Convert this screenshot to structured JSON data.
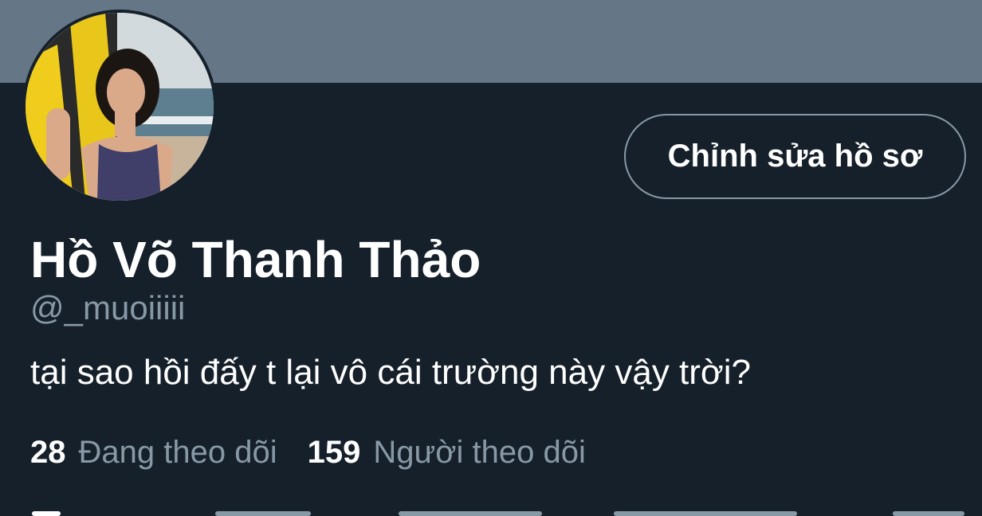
{
  "profile": {
    "display_name": "Hồ Võ Thanh Thảo",
    "handle": "@_muoiiiii",
    "bio": "tại sao hồi đấy t lại vô cái trường này vậy trời?",
    "edit_button_label": "Chỉnh sửa hồ sơ"
  },
  "stats": {
    "following_count": "28",
    "following_label": "Đang theo dõi",
    "followers_count": "159",
    "followers_label": "Người theo dõi"
  },
  "colors": {
    "background": "#15202b",
    "banner": "#657786",
    "primary_text": "#ffffff",
    "secondary_text": "#8899a6"
  }
}
